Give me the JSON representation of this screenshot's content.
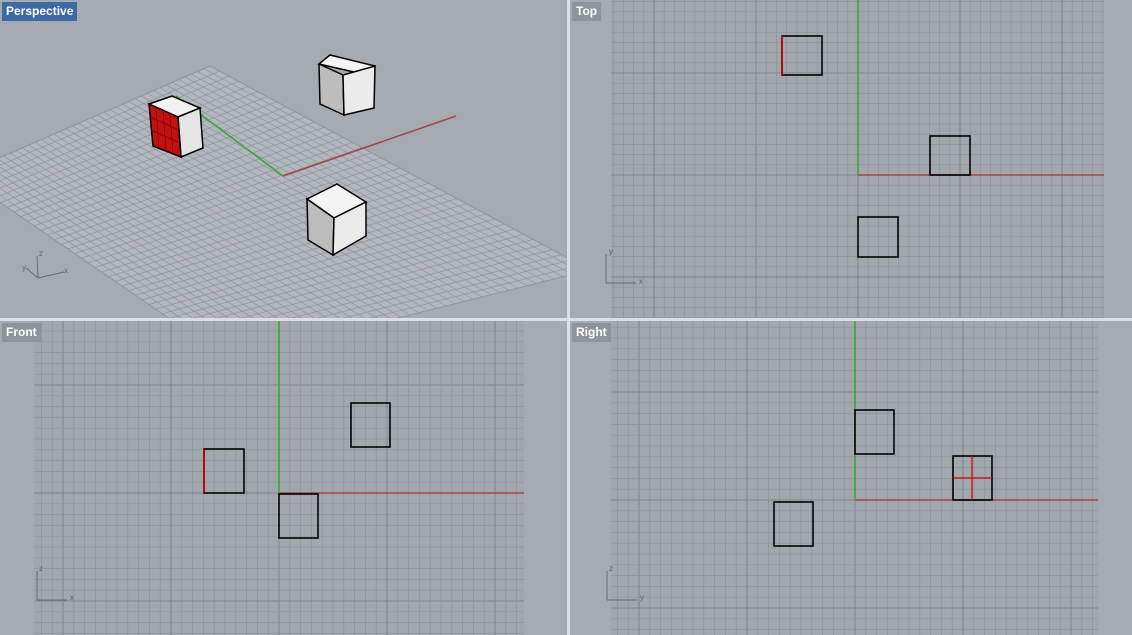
{
  "viewports": {
    "perspective": {
      "label": "Perspective",
      "active": true,
      "axes": {
        "x": "x",
        "y": "y",
        "z": "z"
      }
    },
    "top": {
      "label": "Top",
      "active": false,
      "axes": {
        "h": "x",
        "v": "y"
      }
    },
    "front": {
      "label": "Front",
      "active": false,
      "axes": {
        "h": "x",
        "v": "z"
      }
    },
    "right": {
      "label": "Right",
      "active": false,
      "axes": {
        "h": "y",
        "v": "z"
      }
    }
  },
  "colors": {
    "background": "#a6abb2",
    "grid": "#8e939a",
    "grid_major": "#80858c",
    "x_axis": "#a04646",
    "y_axis": "#3aa23a",
    "selected": "#cc0000",
    "tab_active": "#3c6aa5",
    "tab_inactive": "#8e949b"
  }
}
